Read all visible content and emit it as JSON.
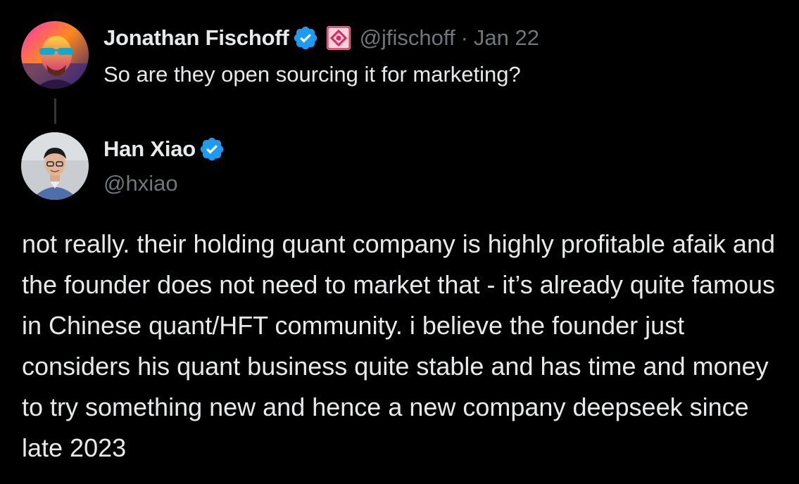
{
  "parent_tweet": {
    "display_name": "Jonathan Fischoff",
    "handle": "@jfischoff",
    "separator": "·",
    "date": "Jan 22",
    "text": "So are they open sourcing it for marketing?"
  },
  "reply_tweet": {
    "display_name": "Han Xiao",
    "handle": "@hxiao",
    "text": "not really. their holding quant company is highly profitable afaik and the founder does not need to market that - it’s already quite famous in Chinese quant/HFT community. i believe the founder just considers his quant business quite stable and has time and money to try something new and hence a new company deepseek since late 2023"
  },
  "icons": {
    "verified": "verified-badge-icon",
    "affiliation": "affiliation-badge-icon"
  },
  "colors": {
    "background": "#000000",
    "text_primary": "#e7e9ea",
    "text_secondary": "#71767b",
    "verified_blue": "#1d9bf0",
    "thread_line": "#333639"
  }
}
